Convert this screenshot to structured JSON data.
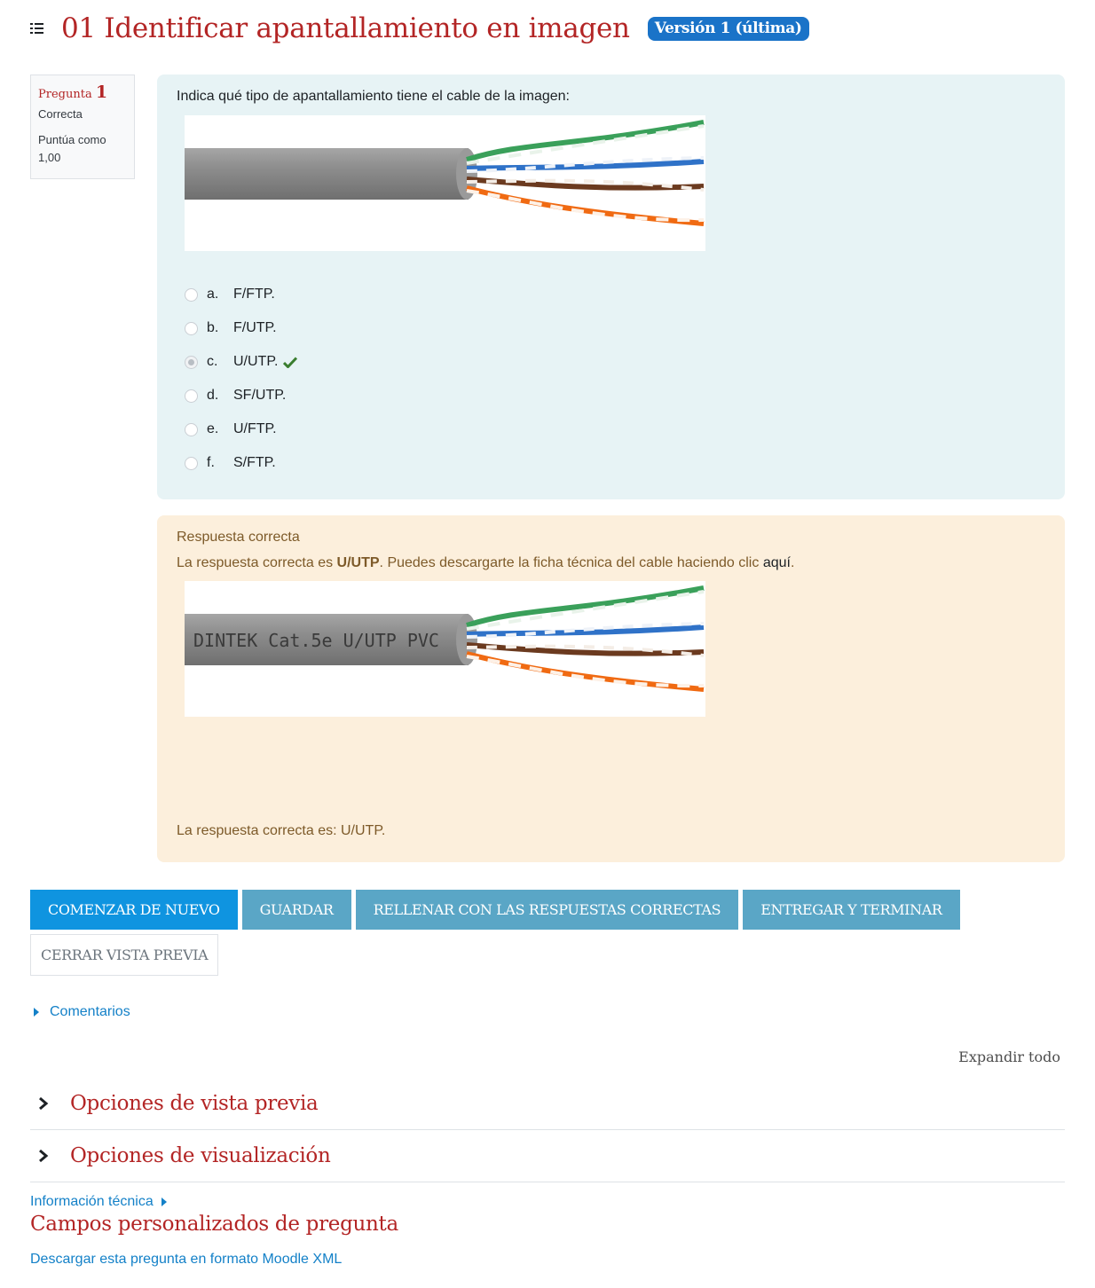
{
  "header": {
    "title": "01 Identificar apantallamiento en imagen",
    "version_badge": "Versión 1 (última)"
  },
  "question_info": {
    "label": "Pregunta",
    "number": "1",
    "state": "Correcta",
    "grade": "Puntúa como 1,00"
  },
  "question": {
    "text": "Indica qué tipo de apantallamiento tiene el cable de la imagen:",
    "answers": [
      {
        "letter": "a.",
        "label": "F/FTP.",
        "checked": false
      },
      {
        "letter": "b.",
        "label": "F/UTP.",
        "checked": false
      },
      {
        "letter": "c.",
        "label": "U/UTP.",
        "checked": true
      },
      {
        "letter": "d.",
        "label": "SF/UTP.",
        "checked": false
      },
      {
        "letter": "e.",
        "label": "U/FTP.",
        "checked": false
      },
      {
        "letter": "f.",
        "label": "S/FTP.",
        "checked": false
      }
    ]
  },
  "feedback": {
    "title": "Respuesta correcta",
    "text_before": "La respuesta correcta es ",
    "text_bold": "U/UTP",
    "text_after": ". Puedes descargarte la ficha técnica del cable haciendo clic ",
    "link": "aquí",
    "text_end": ".",
    "cable_print": "DINTEK Cat.5e U/UTP PVC",
    "right_answer": "La respuesta correcta es: U/UTP."
  },
  "buttons": {
    "restart": "COMENZAR DE NUEVO",
    "save": "GUARDAR",
    "fill_correct": "RELLENAR CON LAS RESPUESTAS CORRECTAS",
    "submit": "ENTREGAR Y TERMINAR",
    "close_preview": "CERRAR VISTA PREVIA"
  },
  "links": {
    "comments": "Comentarios",
    "expand_all": "Expandir todo",
    "tech_info": "Información técnica",
    "download_xml": "Descargar esta pregunta en formato Moodle XML"
  },
  "sections": {
    "preview_options": "Opciones de vista previa",
    "display_options": "Opciones de visualización",
    "custom_fields": "Campos personalizados de pregunta"
  },
  "colors": {
    "title_red": "#b32525",
    "badge_blue": "#1a73c8",
    "primary_button": "#0f94e0",
    "secondary_button": "#5aa6c6",
    "link_blue": "#1481c8",
    "question_bg": "#e7f3f5",
    "feedback_bg": "#fcefdc",
    "correct_green": "#3a7d2f"
  }
}
